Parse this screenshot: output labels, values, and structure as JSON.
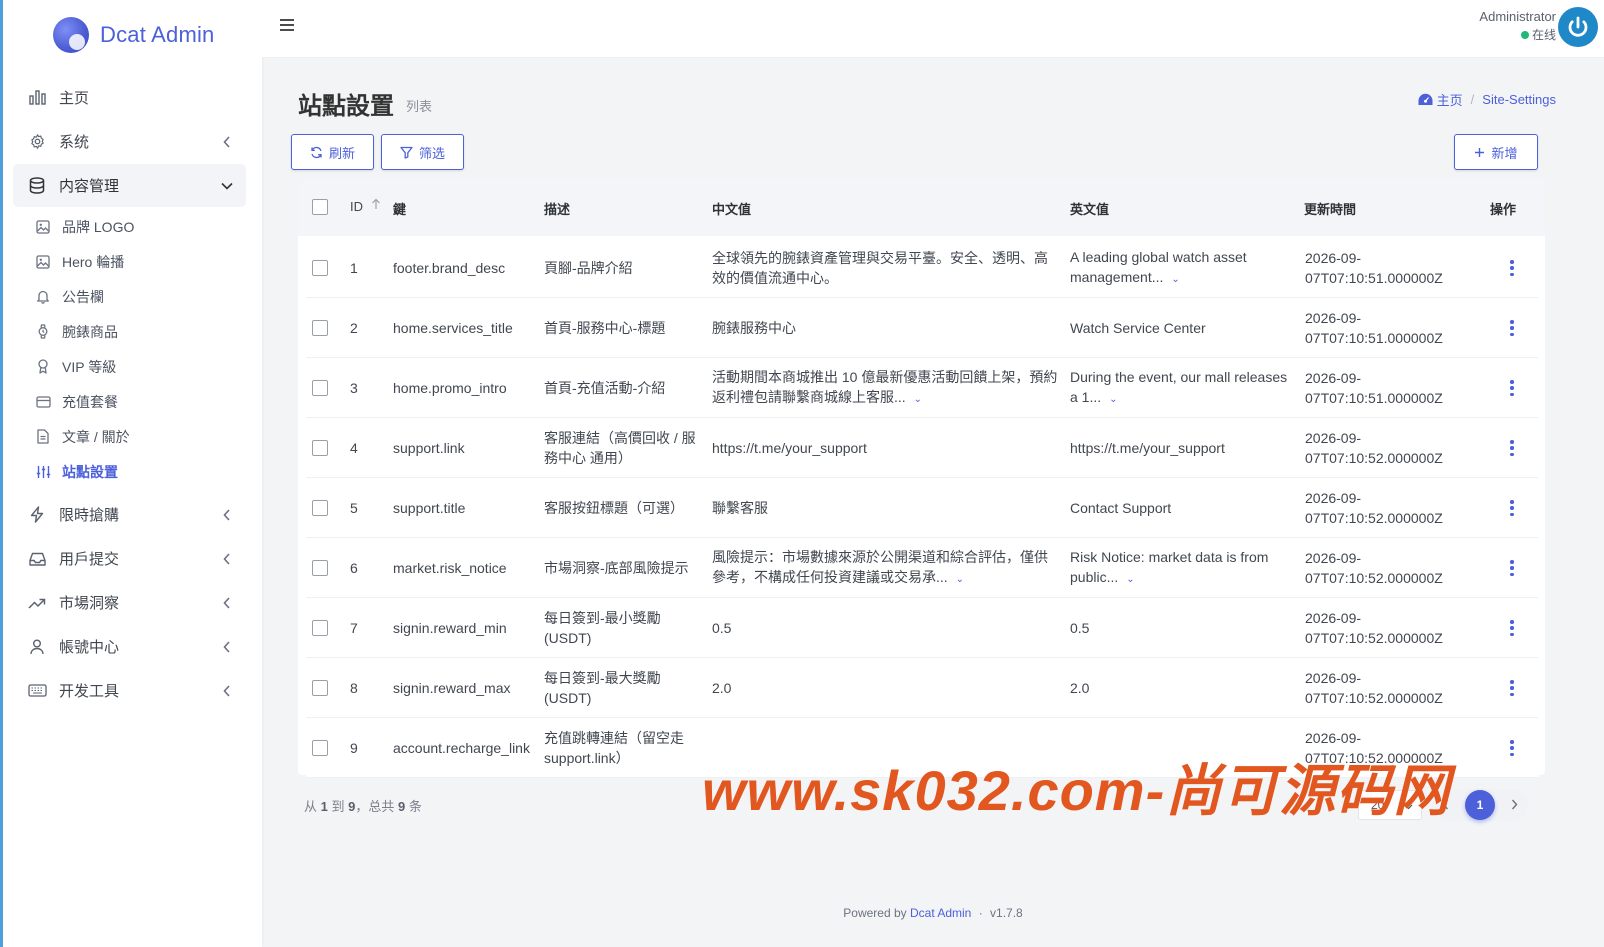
{
  "brand": {
    "name": "Dcat Admin"
  },
  "sidebar": {
    "items": [
      {
        "label": "主页",
        "icon": "bar-chart-icon",
        "has_children": false
      },
      {
        "label": "系统",
        "icon": "gear-icon",
        "has_children": true
      },
      {
        "label": "内容管理",
        "icon": "database-icon",
        "has_children": true,
        "open": true
      },
      {
        "label": "限時搶購",
        "icon": "lightning-icon",
        "has_children": true
      },
      {
        "label": "用戶提交",
        "icon": "inbox-icon",
        "has_children": true
      },
      {
        "label": "市場洞察",
        "icon": "trending-up-icon",
        "has_children": true
      },
      {
        "label": "帳號中心",
        "icon": "user-icon",
        "has_children": true
      },
      {
        "label": "开发工具",
        "icon": "keyboard-icon",
        "has_children": true
      }
    ],
    "sub_items": [
      {
        "label": "品牌 LOGO",
        "icon": "image-icon"
      },
      {
        "label": "Hero 輪播",
        "icon": "image-icon"
      },
      {
        "label": "公告欄",
        "icon": "bell-icon"
      },
      {
        "label": "腕錶商品",
        "icon": "watch-icon"
      },
      {
        "label": "VIP 等級",
        "icon": "award-icon"
      },
      {
        "label": "充值套餐",
        "icon": "credit-card-icon"
      },
      {
        "label": "文章 / 關於",
        "icon": "file-text-icon"
      },
      {
        "label": "站點設置",
        "icon": "sliders-icon",
        "active": true
      }
    ]
  },
  "topbar": {
    "user_name": "Administrator",
    "user_status": "在线"
  },
  "page": {
    "title": "站點設置",
    "description": "列表",
    "breadcrumb": {
      "home": "主页",
      "current": "Site-Settings"
    }
  },
  "toolbar": {
    "refresh_label": "刷新",
    "filter_label": "筛选",
    "create_label": "新增"
  },
  "table": {
    "headers": {
      "id": "ID",
      "key": "鍵",
      "desc": "描述",
      "zh": "中文值",
      "en": "英文值",
      "updated": "更新時間",
      "actions": "操作"
    },
    "rows": [
      {
        "id": "1",
        "key": "footer.brand_desc",
        "desc": "頁腳-品牌介紹",
        "zh": "全球領先的腕錶資產管理與交易平臺。安全、透明、高效的價值流通中心。",
        "zh_more": false,
        "en": "A leading global watch asset management...",
        "en_more": true,
        "updated": "2026-09-07T07:10:51.000000Z"
      },
      {
        "id": "2",
        "key": "home.services_title",
        "desc": "首頁-服務中心-標題",
        "zh": "腕錶服務中心",
        "zh_more": false,
        "en": "Watch Service Center",
        "en_more": false,
        "updated": "2026-09-07T07:10:51.000000Z"
      },
      {
        "id": "3",
        "key": "home.promo_intro",
        "desc": "首頁-充值活動-介紹",
        "zh": "活動期間本商城推出 10 億最新優惠活動回饋上架，預約返利禮包請聯繫商城線上客服...",
        "zh_more": true,
        "en": "During the event, our mall releases a 1...",
        "en_more": true,
        "updated": "2026-09-07T07:10:51.000000Z"
      },
      {
        "id": "4",
        "key": "support.link",
        "desc": "客服連結（高價回收 / 服務中心 通用）",
        "zh": "https://t.me/your_support",
        "zh_more": false,
        "en": "https://t.me/your_support",
        "en_more": false,
        "updated": "2026-09-07T07:10:52.000000Z"
      },
      {
        "id": "5",
        "key": "support.title",
        "desc": "客服按鈕標題（可選）",
        "zh": "聯繫客服",
        "zh_more": false,
        "en": "Contact Support",
        "en_more": false,
        "updated": "2026-09-07T07:10:52.000000Z"
      },
      {
        "id": "6",
        "key": "market.risk_notice",
        "desc": "市場洞察-底部風險提示",
        "zh": "風險提示：市場數據來源於公開渠道和綜合評估，僅供參考，不構成任何投資建議或交易承...",
        "zh_more": true,
        "en": "Risk Notice: market data is from public...",
        "en_more": true,
        "updated": "2026-09-07T07:10:52.000000Z"
      },
      {
        "id": "7",
        "key": "signin.reward_min",
        "desc": "每日簽到-最小獎勵 (USDT)",
        "zh": "0.5",
        "zh_more": false,
        "en": "0.5",
        "en_more": false,
        "updated": "2026-09-07T07:10:52.000000Z"
      },
      {
        "id": "8",
        "key": "signin.reward_max",
        "desc": "每日簽到-最大獎勵 (USDT)",
        "zh": "2.0",
        "zh_more": false,
        "en": "2.0",
        "en_more": false,
        "updated": "2026-09-07T07:10:52.000000Z"
      },
      {
        "id": "9",
        "key": "account.recharge_link",
        "desc": "充值跳轉連結（留空走 support.link）",
        "zh": "",
        "zh_more": false,
        "en": "",
        "en_more": false,
        "updated": "2026-09-07T07:10:52.000000Z"
      }
    ]
  },
  "pagination": {
    "summary_prefix": "从",
    "from": "1",
    "to_word": "到",
    "to": "9",
    "total_word": "，总共",
    "total": "9",
    "unit": "条",
    "per_page": "20",
    "current_page": "1"
  },
  "watermark": "www.sk032.com-尚可源码网",
  "footer": {
    "powered_by": "Powered by",
    "link": "Dcat Admin",
    "sep": "·",
    "version": "v1.7.8"
  },
  "colors": {
    "primary": "#4c60da",
    "online": "#21b978",
    "avatar": "#1e88c9",
    "watermark": "#e2561f"
  }
}
